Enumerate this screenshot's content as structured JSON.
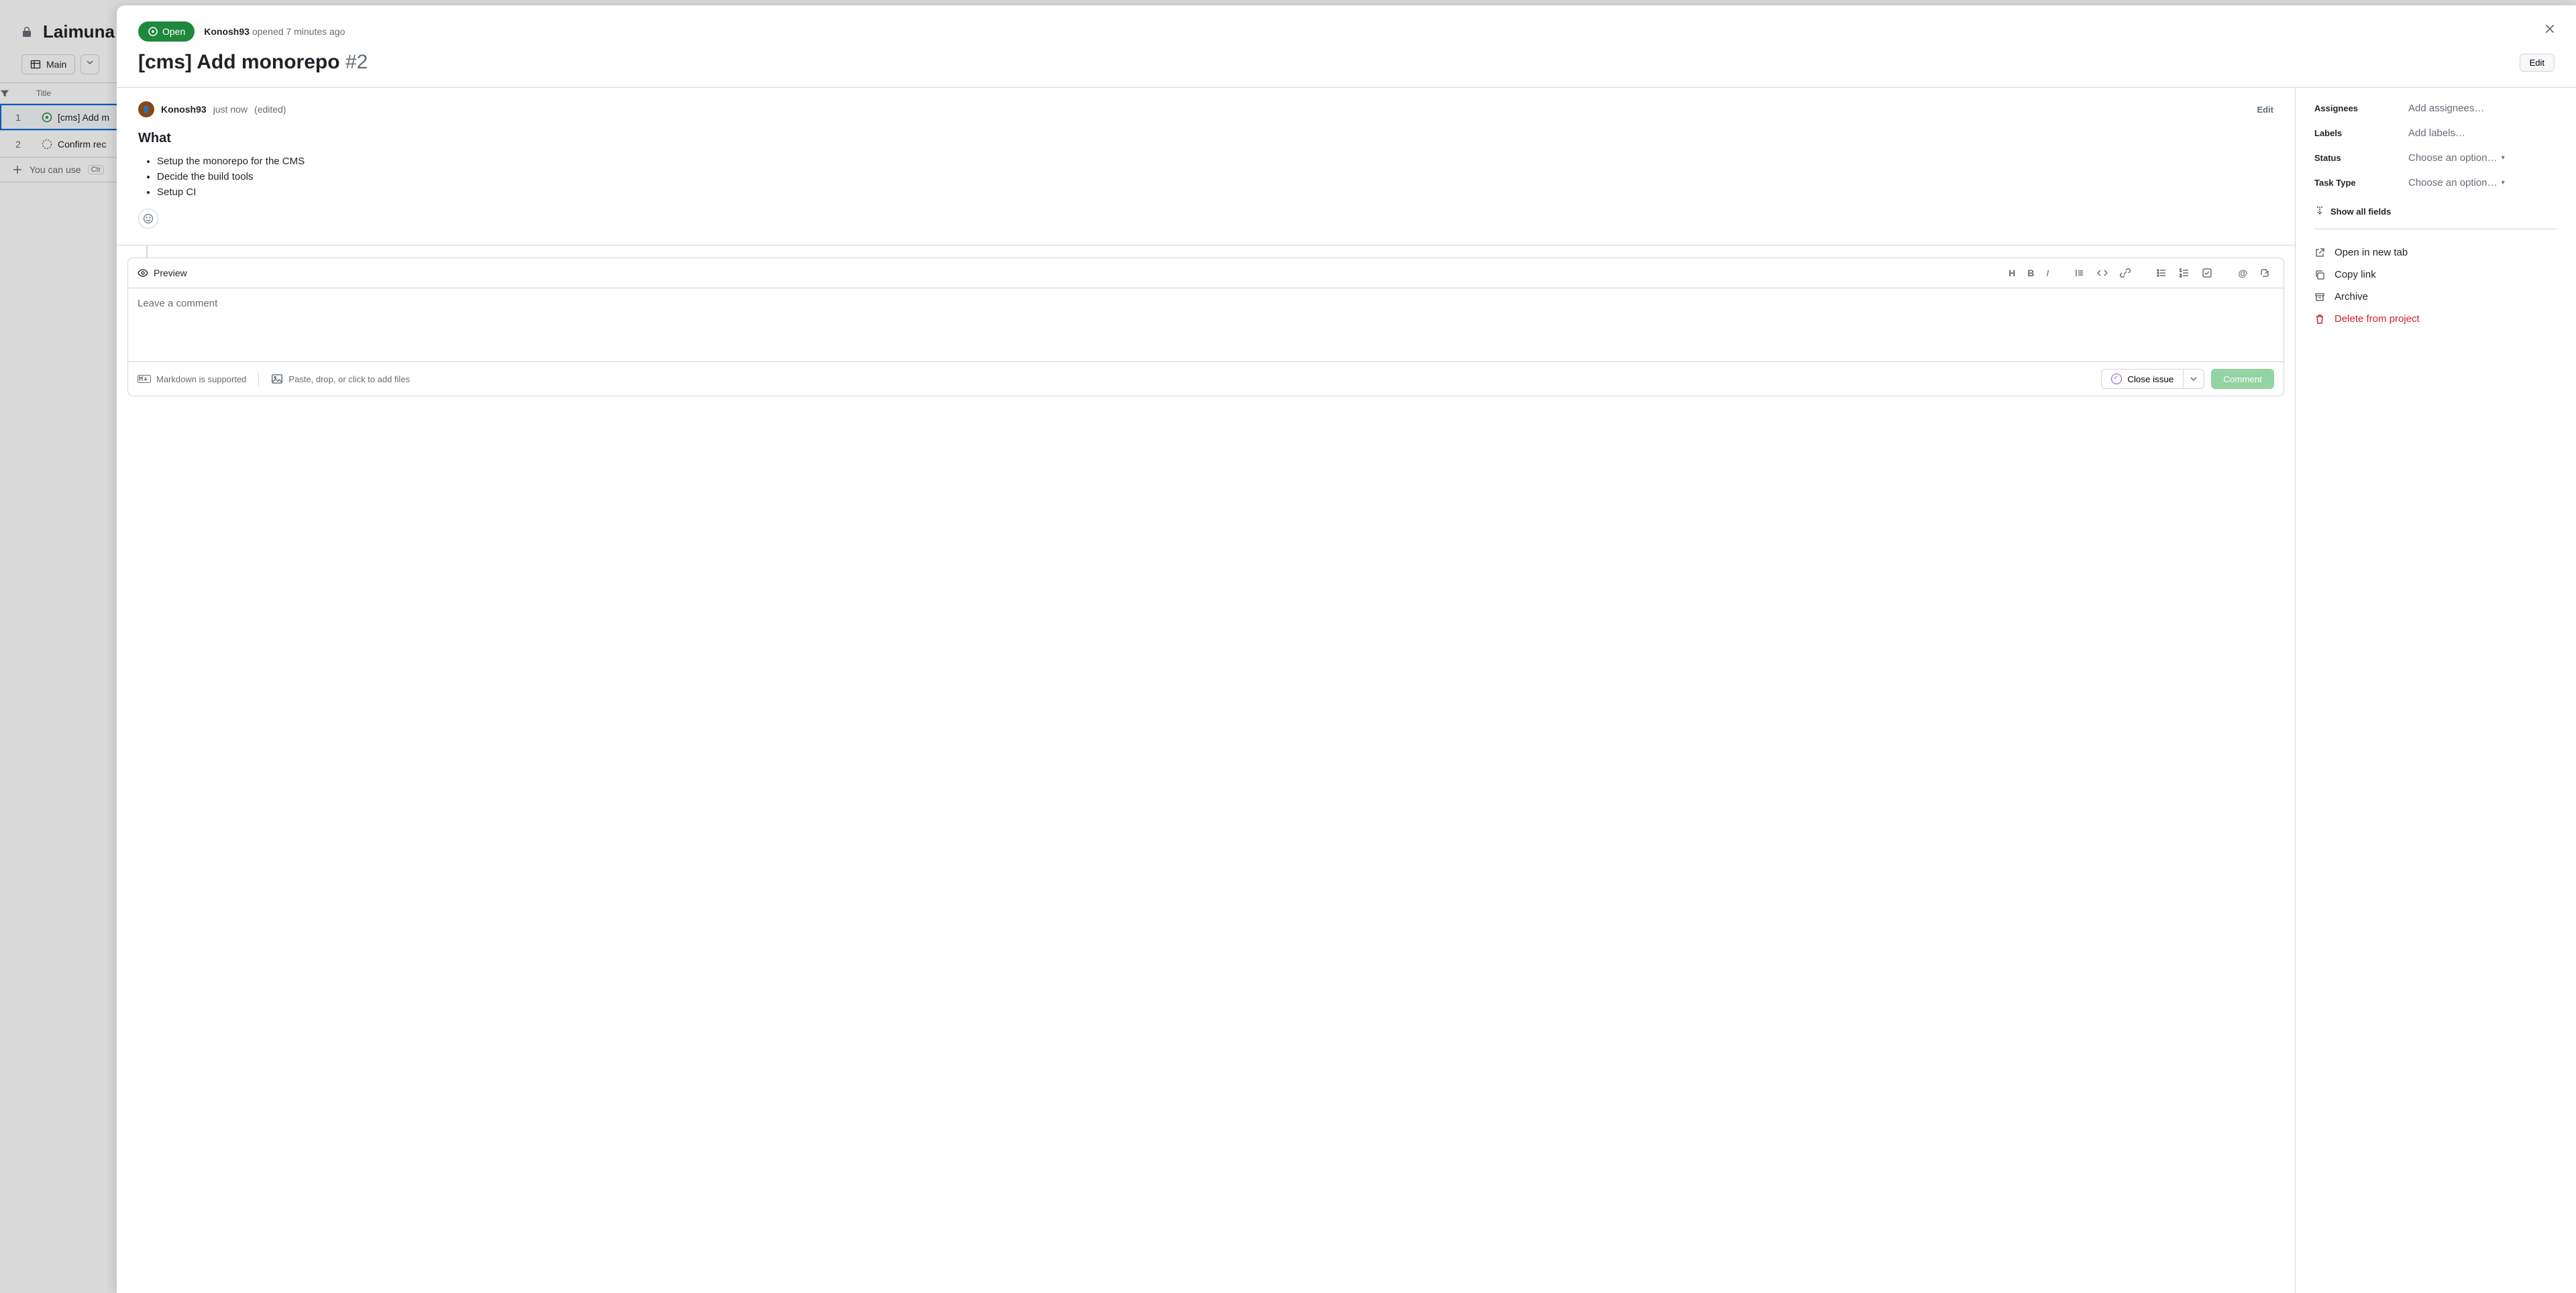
{
  "background": {
    "project_title": "Laimuna CM",
    "view_label": "Main",
    "column_title": "Title",
    "rows": [
      {
        "num": "1",
        "title": "[cms] Add m"
      },
      {
        "num": "2",
        "title": "Confirm rec"
      }
    ],
    "add_hint_prefix": "You can use",
    "add_hint_kbd": "Ctr"
  },
  "modal": {
    "state": "Open",
    "author": "Konosh93",
    "opened": "opened 7 minutes ago",
    "title": "[cms] Add monorepo",
    "issue_number": "#2",
    "edit": "Edit"
  },
  "comment": {
    "author": "Konosh93",
    "time": "just now",
    "edited": "(edited)",
    "edit": "Edit",
    "heading": "What",
    "bullets": [
      "Setup the monorepo for the CMS",
      "Decide the build tools",
      "Setup CI"
    ]
  },
  "composer": {
    "preview": "Preview",
    "placeholder": "Leave a comment",
    "md_hint": "Markdown is supported",
    "file_hint": "Paste, drop, or click to add files",
    "close_label": "Close issue",
    "comment_label": "Comment"
  },
  "sidebar": {
    "fields": [
      {
        "label": "Assignees",
        "value": "Add assignees…",
        "caret": false
      },
      {
        "label": "Labels",
        "value": "Add labels…",
        "caret": false
      },
      {
        "label": "Status",
        "value": "Choose an option…",
        "caret": true
      },
      {
        "label": "Task Type",
        "value": "Choose an option…",
        "caret": true
      }
    ],
    "show_all": "Show all fields",
    "actions": {
      "open_tab": "Open in new tab",
      "copy_link": "Copy link",
      "archive": "Archive",
      "delete": "Delete from project"
    }
  }
}
